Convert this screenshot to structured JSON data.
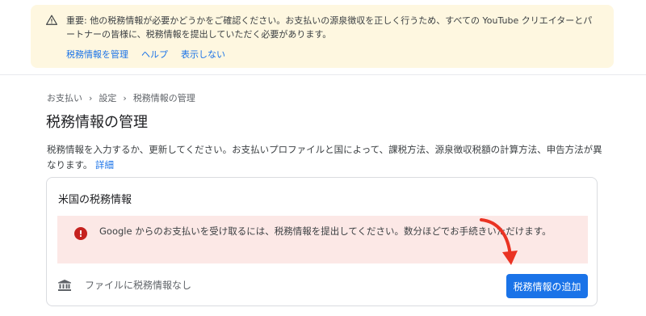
{
  "banner": {
    "text": "重要: 他の税務情報が必要かどうかをご確認ください。お支払いの源泉徴収を正しく行うため、すべての YouTube クリエイターとパートナーの皆様に、税務情報を提出していただく必要があります。",
    "actions": [
      "税務情報を管理",
      "ヘルプ",
      "表示しない"
    ],
    "icon": "warning-icon"
  },
  "breadcrumb": [
    "お支払い",
    "設定",
    "税務情報の管理"
  ],
  "page_title": "税務情報の管理",
  "description": {
    "text": "税務情報を入力するか、更新してください。お支払いプロファイルと国によって、課税方法、源泉徴収税額の計算方法、申告方法が異なります。",
    "link": "詳細"
  },
  "card": {
    "title": "米国の税務情報",
    "alert_text": "Google からのお支払いを受け取るには、税務情報を提出してください。数分ほどでお手続きいただけます。",
    "file_status": "ファイルに税務情報なし",
    "add_button": "税務情報の追加"
  },
  "colors": {
    "banner_bg": "#fef7e0",
    "alert_bg": "#fce8e6",
    "error_red": "#c5221f",
    "link_blue": "#1a73e8",
    "arrow_red": "#ea3323"
  }
}
